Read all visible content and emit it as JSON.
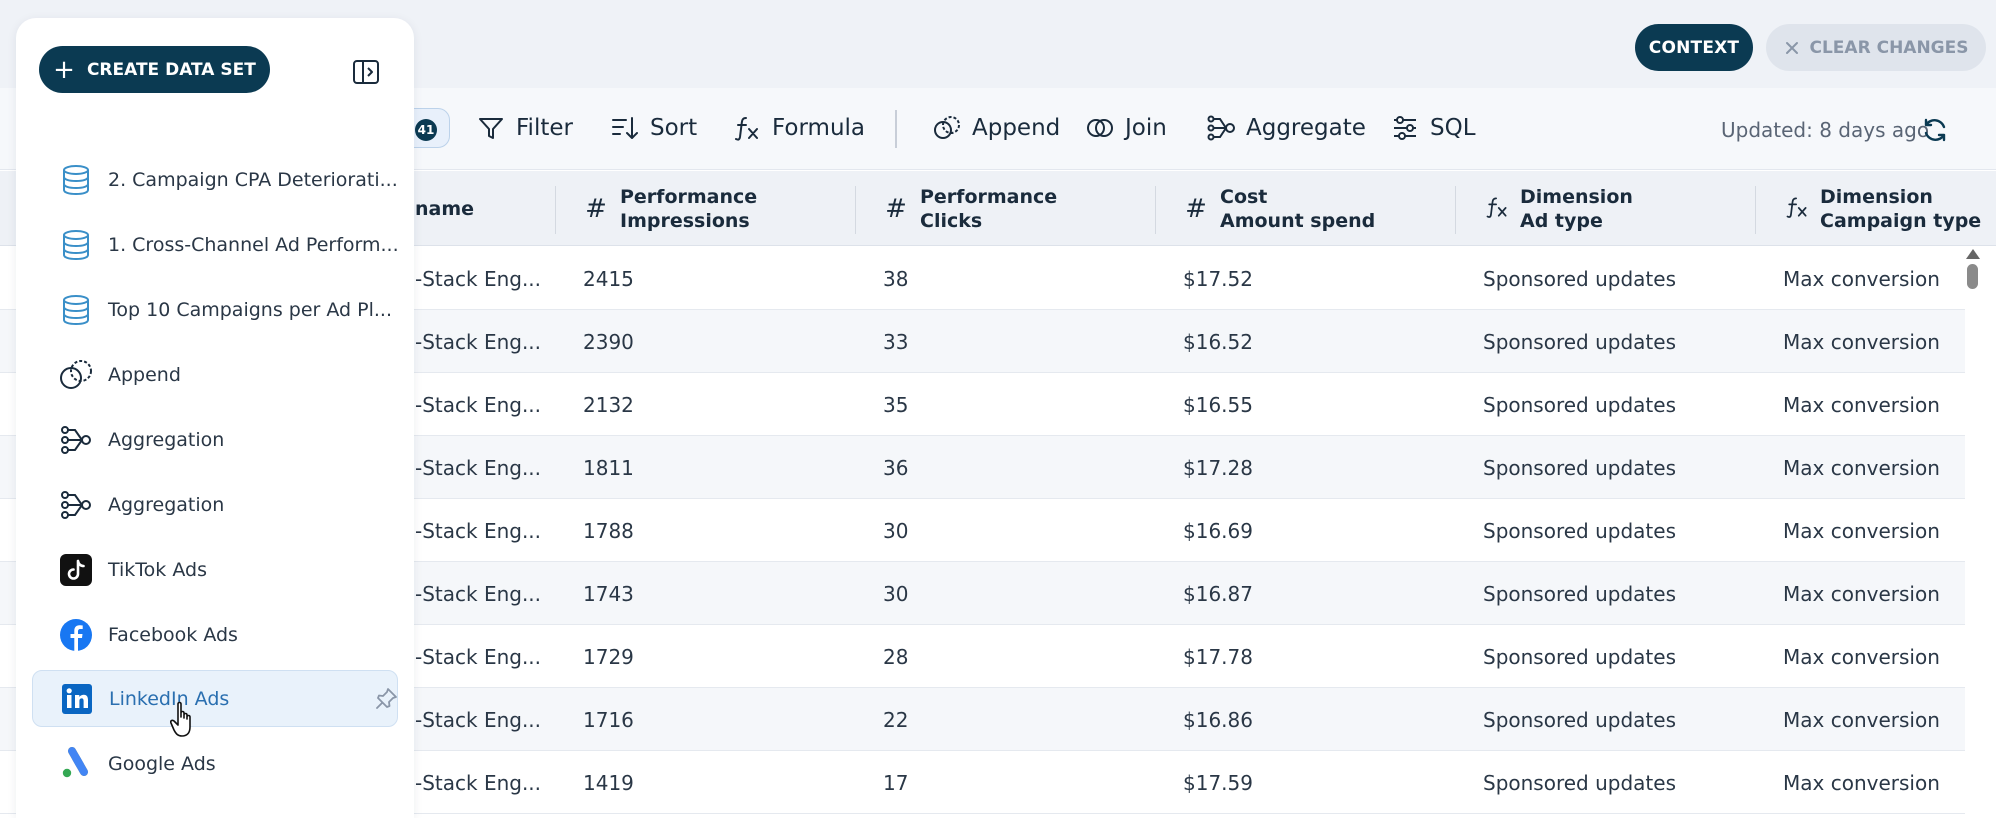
{
  "header": {
    "context_label": "CONTEXT",
    "clear_label": "CLEAR CHANGES"
  },
  "toolbar": {
    "badge_count": "41",
    "filter": "Filter",
    "sort": "Sort",
    "formula": "Formula",
    "append": "Append",
    "join": "Join",
    "aggregate": "Aggregate",
    "sql": "SQL",
    "updated": "Updated: 8 days ago"
  },
  "table": {
    "columns": [
      {
        "icon": "",
        "line1": "",
        "line2": "name"
      },
      {
        "icon": "#",
        "line1": "Performance",
        "line2": "Impressions"
      },
      {
        "icon": "#",
        "line1": "Performance",
        "line2": "Clicks"
      },
      {
        "icon": "#",
        "line1": "Cost",
        "line2": "Amount spend"
      },
      {
        "icon": "fx",
        "line1": "Dimension",
        "line2": "Ad type"
      },
      {
        "icon": "fx",
        "line1": "Dimension",
        "line2": "Campaign type"
      }
    ],
    "rows": [
      [
        "-Stack Eng...",
        "2415",
        "38",
        "$17.52",
        "Sponsored updates",
        "Max conversion"
      ],
      [
        "-Stack Eng...",
        "2390",
        "33",
        "$16.52",
        "Sponsored updates",
        "Max conversion"
      ],
      [
        "-Stack Eng...",
        "2132",
        "35",
        "$16.55",
        "Sponsored updates",
        "Max conversion"
      ],
      [
        "-Stack Eng...",
        "1811",
        "36",
        "$17.28",
        "Sponsored updates",
        "Max conversion"
      ],
      [
        "-Stack Eng...",
        "1788",
        "30",
        "$16.69",
        "Sponsored updates",
        "Max conversion"
      ],
      [
        "-Stack Eng...",
        "1743",
        "30",
        "$16.87",
        "Sponsored updates",
        "Max conversion"
      ],
      [
        "-Stack Eng...",
        "1729",
        "28",
        "$17.78",
        "Sponsored updates",
        "Max conversion"
      ],
      [
        "-Stack Eng...",
        "1716",
        "22",
        "$16.86",
        "Sponsored updates",
        "Max conversion"
      ],
      [
        "-Stack Eng...",
        "1419",
        "17",
        "$17.59",
        "Sponsored updates",
        "Max conversion"
      ]
    ]
  },
  "sidebar": {
    "create_label": "CREATE DATA SET",
    "items": [
      {
        "label": "2. Campaign CPA Deteriorati...",
        "icon": "database-icon"
      },
      {
        "label": "1. Cross-Channel Ad Perform...",
        "icon": "database-icon"
      },
      {
        "label": "Top 10 Campaigns per Ad Pl...",
        "icon": "database-icon"
      },
      {
        "label": "Append",
        "icon": "append-icon"
      },
      {
        "label": "Aggregation",
        "icon": "aggregation-icon"
      },
      {
        "label": "Aggregation",
        "icon": "aggregation-icon"
      },
      {
        "label": "TikTok Ads",
        "icon": "tiktok-icon"
      },
      {
        "label": "Facebook Ads",
        "icon": "facebook-icon"
      },
      {
        "label": "LinkedIn Ads",
        "icon": "linkedin-icon"
      },
      {
        "label": "Google Ads",
        "icon": "google-ads-icon"
      }
    ]
  },
  "colors": {
    "primary": "#0b3a52",
    "accent": "#2a6fb0",
    "database": "#3a8fc8",
    "facebook": "#1877f2",
    "linkedin": "#0a66c2"
  }
}
